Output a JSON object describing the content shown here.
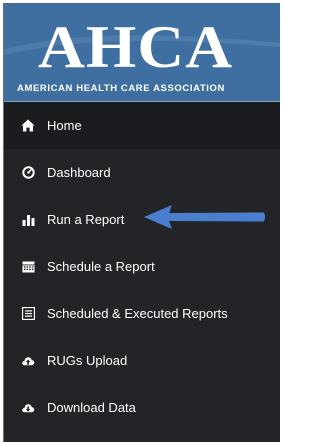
{
  "logo": {
    "title": "AHCA",
    "subtitle": "AMERICAN HEALTH CARE ASSOCIATION"
  },
  "nav": {
    "items": [
      {
        "label": "Home",
        "icon": "home-icon",
        "active": true
      },
      {
        "label": "Dashboard",
        "icon": "gauge-icon"
      },
      {
        "label": "Run a Report",
        "icon": "bar-chart-icon"
      },
      {
        "label": "Schedule a Report",
        "icon": "calendar-icon"
      },
      {
        "label": "Scheduled & Executed Reports",
        "icon": "list-icon"
      },
      {
        "label": "RUGs Upload",
        "icon": "cloud-upload-icon"
      },
      {
        "label": "Download Data",
        "icon": "cloud-download-icon"
      }
    ]
  },
  "colors": {
    "sidebar_bg": "#232428",
    "active_bg": "#1b1c1f",
    "logo_bg": "#3f6fa1",
    "arrow": "#4a7fd0"
  }
}
